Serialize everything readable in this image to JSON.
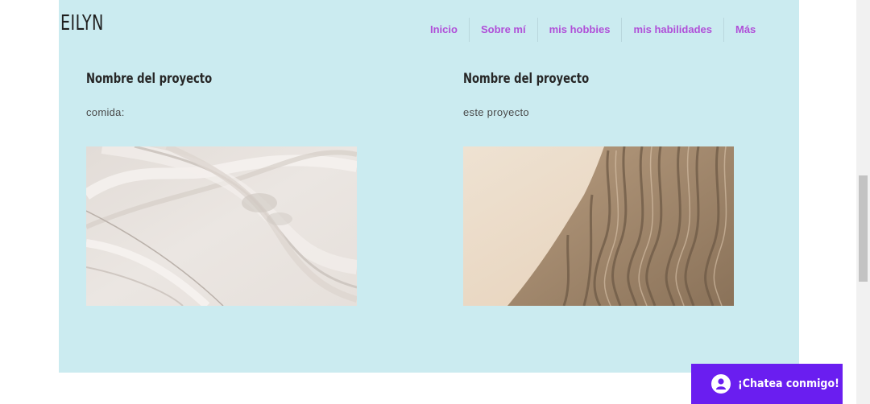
{
  "header": {
    "logo": "EILYN",
    "nav": [
      {
        "label": "Inicio"
      },
      {
        "label": "Sobre mí"
      },
      {
        "label": "mis hobbies"
      },
      {
        "label": "mis habilidades"
      },
      {
        "label": "Más"
      }
    ]
  },
  "projects": [
    {
      "title": "Nombre del proyecto",
      "description": "comida:"
    },
    {
      "title": "Nombre del proyecto",
      "description": "este proyecto"
    }
  ],
  "chat": {
    "label": "¡Chatea conmigo!"
  },
  "colors": {
    "panel_bg": "#cbebf0",
    "nav_text": "#b04fd8",
    "chat_bg": "#6a1ef0"
  }
}
